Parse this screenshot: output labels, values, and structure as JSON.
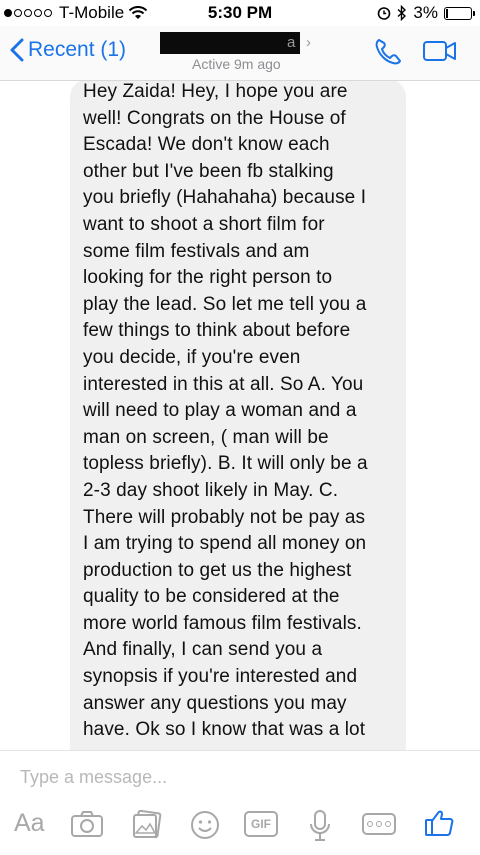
{
  "status_bar": {
    "carrier": "T-Mobile",
    "time": "5:30 PM",
    "battery": "3%"
  },
  "nav": {
    "back_label": "Recent (1)",
    "contact_name_fragment": "a",
    "active_status": "Active 9m ago"
  },
  "message": {
    "text": "Hey Zaida! Hey, I hope you are\nwell! Congrats on the House of\nEscada! We don't know each\nother but I've been fb stalking\nyou briefly (Hahahaha) because I\nwant to shoot a short film for\nsome film festivals and am\nlooking for the right person to\nplay the lead. So let me tell you a\nfew things to think about before\nyou decide, if you're even\ninterested in this at all. So A. You\nwill need to play a woman and a\nman on screen, ( man will be\ntopless briefly). B. It will only be a\n2-3 day shoot likely in May. C.\nThere will probably not be pay as\nI am trying to spend all money on\nproduction to get us the highest\nquality to be considered at the\nmore world famous film festivals.\nAnd finally, I can send you a\nsynopsis if you're interested and\nanswer any questions you may\nhave. Ok so I know that was a lot"
  },
  "composer": {
    "placeholder": "Type a message...",
    "aa_label": "Aa",
    "gif_label": "GIF"
  },
  "icons": [
    "signal-dots-icon",
    "wifi-icon",
    "alarm-icon",
    "bluetooth-icon",
    "battery-icon",
    "chevron-left-icon",
    "chevron-right-icon",
    "phone-icon",
    "video-camera-icon",
    "camera-icon",
    "photo-gallery-icon",
    "emoji-icon",
    "gif-icon",
    "microphone-icon",
    "more-icon",
    "thumbs-up-icon"
  ],
  "colors": {
    "accent": "#1a73e8",
    "bubble_bg": "#f1f0f0",
    "icon_gray": "#a8a8a8"
  }
}
